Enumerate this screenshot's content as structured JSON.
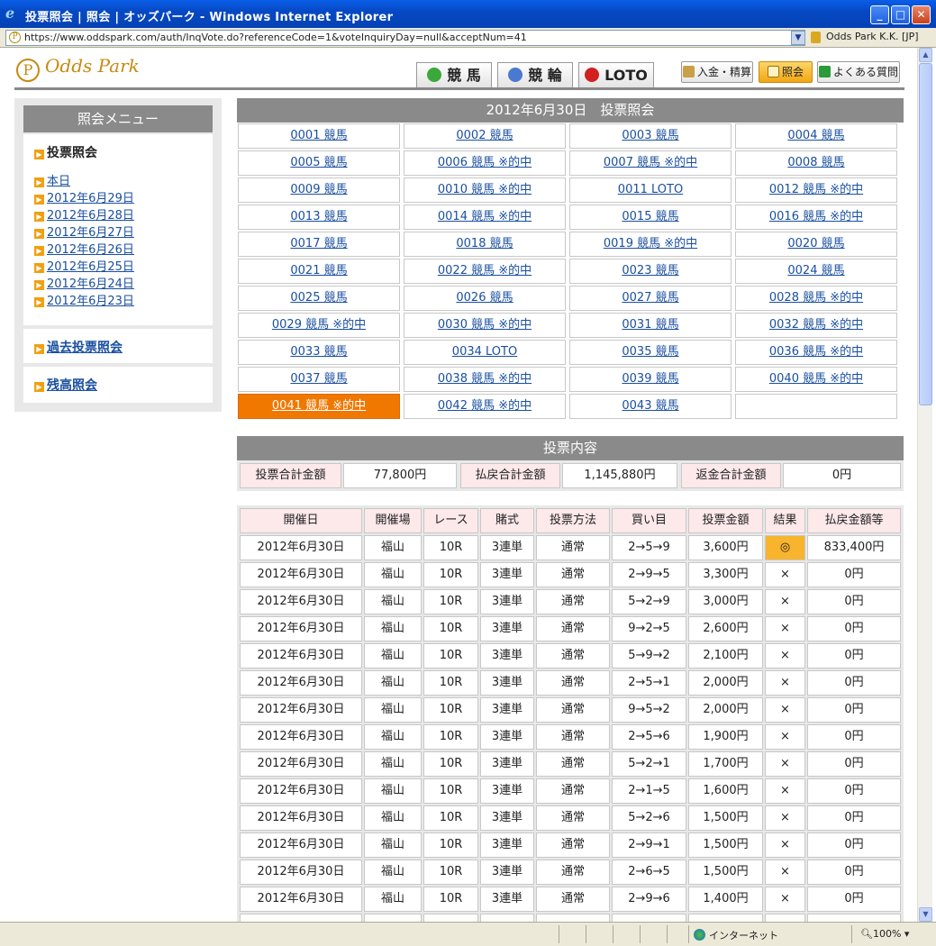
{
  "window": {
    "title": "投票照会 | 照会 | オッズパーク - Windows Internet Explorer",
    "min": "_",
    "max": "□",
    "close": "✕"
  },
  "address": {
    "url": "https://www.oddspark.com/auth/InqVote.do?referenceCode=1&voteInquiryDay=null&acceptNum=41",
    "ssl": "Odds Park K.K. [JP]"
  },
  "header": {
    "logo": "Odds Park",
    "tabs": [
      {
        "label": "競 馬"
      },
      {
        "label": "競 輪"
      },
      {
        "label": "LOTO"
      }
    ],
    "buttons": [
      {
        "label": "入金・精算"
      },
      {
        "label": "照会"
      },
      {
        "label": "よくある質問"
      }
    ]
  },
  "sidebar": {
    "title": "照会メニュー",
    "section": "投票照会",
    "dates": [
      "本日",
      "2012年6月29日",
      "2012年6月28日",
      "2012年6月27日",
      "2012年6月26日",
      "2012年6月25日",
      "2012年6月24日",
      "2012年6月23日"
    ],
    "past": "過去投票照会",
    "balance": "残高照会"
  },
  "main": {
    "title": "2012年6月30日　投票照会",
    "votes": [
      "0001 競馬",
      "0002 競馬",
      "0003 競馬",
      "0004 競馬",
      "0005 競馬",
      "0006 競馬 ※的中",
      "0007 競馬 ※的中",
      "0008 競馬",
      "0009 競馬",
      "0010 競馬 ※的中",
      "0011 LOTO",
      "0012 競馬 ※的中",
      "0013 競馬",
      "0014 競馬 ※的中",
      "0015 競馬",
      "0016 競馬 ※的中",
      "0017 競馬",
      "0018 競馬",
      "0019 競馬 ※的中",
      "0020 競馬",
      "0021 競馬",
      "0022 競馬 ※的中",
      "0023 競馬",
      "0024 競馬",
      "0025 競馬",
      "0026 競馬",
      "0027 競馬",
      "0028 競馬 ※的中",
      "0029 競馬 ※的中",
      "0030 競馬 ※的中",
      "0031 競馬",
      "0032 競馬 ※的中",
      "0033 競馬",
      "0034 LOTO",
      "0035 競馬",
      "0036 競馬 ※的中",
      "0037 競馬",
      "0038 競馬 ※的中",
      "0039 競馬",
      "0040 競馬 ※的中",
      "0041 競馬 ※的中",
      "0042 競馬 ※的中",
      "0043 競馬"
    ],
    "selected_vote": "0041 競馬 ※的中",
    "content_title": "投票内容",
    "summary": {
      "total_label": "投票合計金額",
      "total_value": "77,800円",
      "payout_label": "払戻合計金額",
      "payout_value": "1,145,880円",
      "refund_label": "返金合計金額",
      "refund_value": "0円"
    },
    "table": {
      "headers": [
        "開催日",
        "開催場",
        "レース",
        "賭式",
        "投票方法",
        "買い目",
        "投票金額",
        "結果",
        "払戻金額等"
      ],
      "rows": [
        [
          "2012年6月30日",
          "福山",
          "10R",
          "3連単",
          "通常",
          "2→5→9",
          "3,600円",
          "◎",
          "833,400円"
        ],
        [
          "2012年6月30日",
          "福山",
          "10R",
          "3連単",
          "通常",
          "2→9→5",
          "3,300円",
          "×",
          "0円"
        ],
        [
          "2012年6月30日",
          "福山",
          "10R",
          "3連単",
          "通常",
          "5→2→9",
          "3,000円",
          "×",
          "0円"
        ],
        [
          "2012年6月30日",
          "福山",
          "10R",
          "3連単",
          "通常",
          "9→2→5",
          "2,600円",
          "×",
          "0円"
        ],
        [
          "2012年6月30日",
          "福山",
          "10R",
          "3連単",
          "通常",
          "5→9→2",
          "2,100円",
          "×",
          "0円"
        ],
        [
          "2012年6月30日",
          "福山",
          "10R",
          "3連単",
          "通常",
          "2→5→1",
          "2,000円",
          "×",
          "0円"
        ],
        [
          "2012年6月30日",
          "福山",
          "10R",
          "3連単",
          "通常",
          "9→5→2",
          "2,000円",
          "×",
          "0円"
        ],
        [
          "2012年6月30日",
          "福山",
          "10R",
          "3連単",
          "通常",
          "2→5→6",
          "1,900円",
          "×",
          "0円"
        ],
        [
          "2012年6月30日",
          "福山",
          "10R",
          "3連単",
          "通常",
          "5→2→1",
          "1,700円",
          "×",
          "0円"
        ],
        [
          "2012年6月30日",
          "福山",
          "10R",
          "3連単",
          "通常",
          "2→1→5",
          "1,600円",
          "×",
          "0円"
        ],
        [
          "2012年6月30日",
          "福山",
          "10R",
          "3連単",
          "通常",
          "5→2→6",
          "1,500円",
          "×",
          "0円"
        ],
        [
          "2012年6月30日",
          "福山",
          "10R",
          "3連単",
          "通常",
          "2→9→1",
          "1,500円",
          "×",
          "0円"
        ],
        [
          "2012年6月30日",
          "福山",
          "10R",
          "3連単",
          "通常",
          "2→6→5",
          "1,500円",
          "×",
          "0円"
        ],
        [
          "2012年6月30日",
          "福山",
          "10R",
          "3連単",
          "通常",
          "2→9→6",
          "1,400円",
          "×",
          "0円"
        ]
      ]
    }
  },
  "statusbar": {
    "zone": "インターネット",
    "zoom": "100%"
  }
}
